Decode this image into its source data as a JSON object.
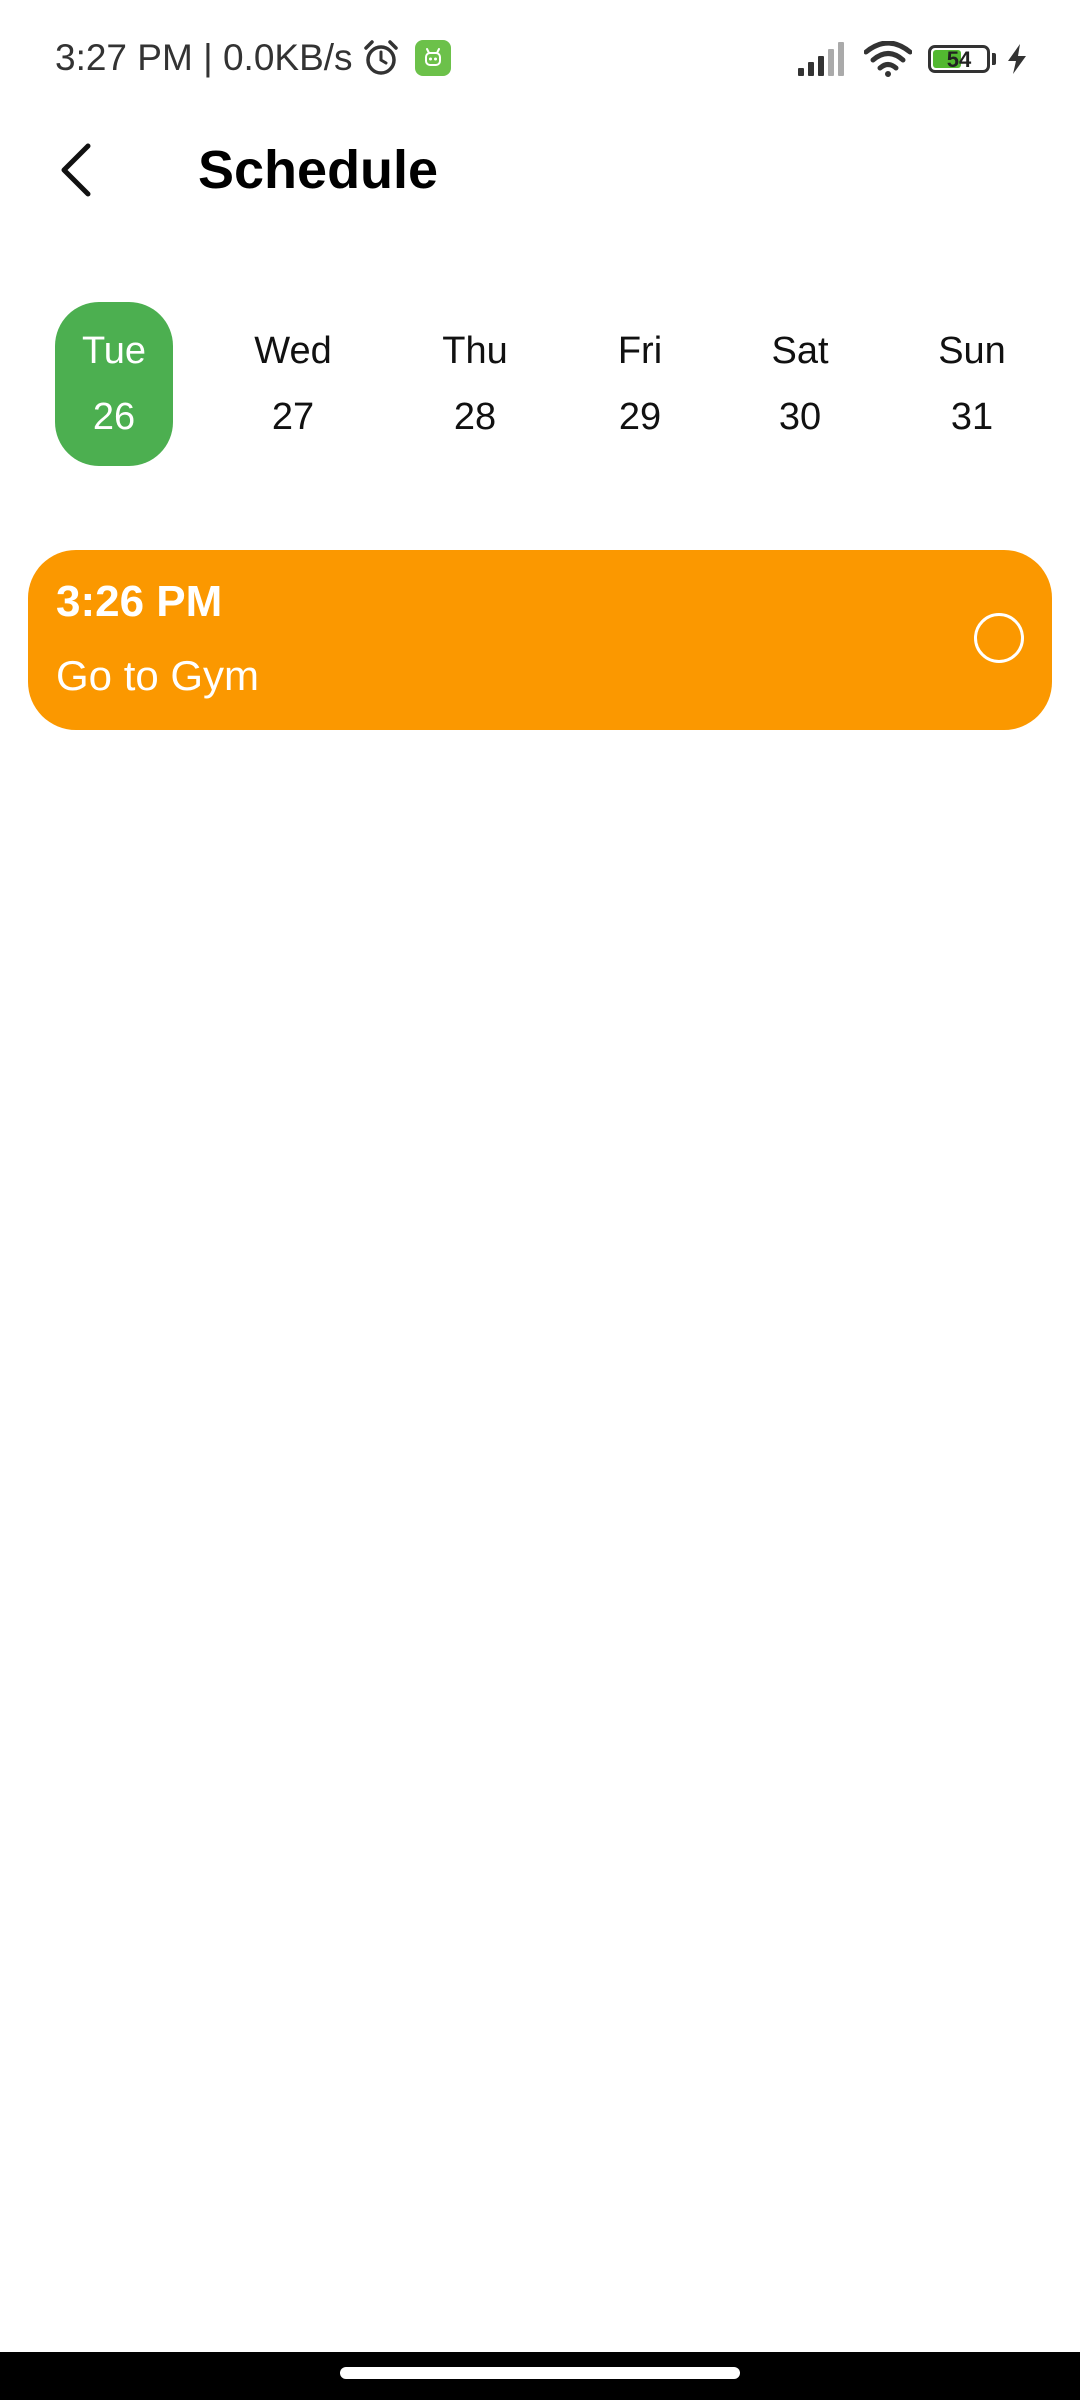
{
  "status_bar": {
    "time_speed": "3:27 PM | 0.0KB/s",
    "battery_level": "54",
    "battery_fraction": 0.54,
    "icons": [
      "alarm-icon",
      "app-notification-icon",
      "signal-icon",
      "wifi-icon",
      "battery-icon",
      "charging-icon"
    ]
  },
  "header": {
    "title": "Schedule",
    "back_icon": "chevron-left-icon"
  },
  "week": {
    "days": [
      {
        "name": "Tue",
        "date": "26",
        "selected": true
      },
      {
        "name": "Wed",
        "date": "27",
        "selected": false
      },
      {
        "name": "Thu",
        "date": "28",
        "selected": false
      },
      {
        "name": "Fri",
        "date": "29",
        "selected": false
      },
      {
        "name": "Sat",
        "date": "30",
        "selected": false
      },
      {
        "name": "Sun",
        "date": "31",
        "selected": false
      }
    ]
  },
  "tasks": [
    {
      "time": "3:26 PM",
      "title": "Go to Gym",
      "done": false
    }
  ],
  "colors": {
    "selected_day": "#4caf50",
    "task_card": "#fb9800",
    "battery_fill": "#52b830"
  }
}
